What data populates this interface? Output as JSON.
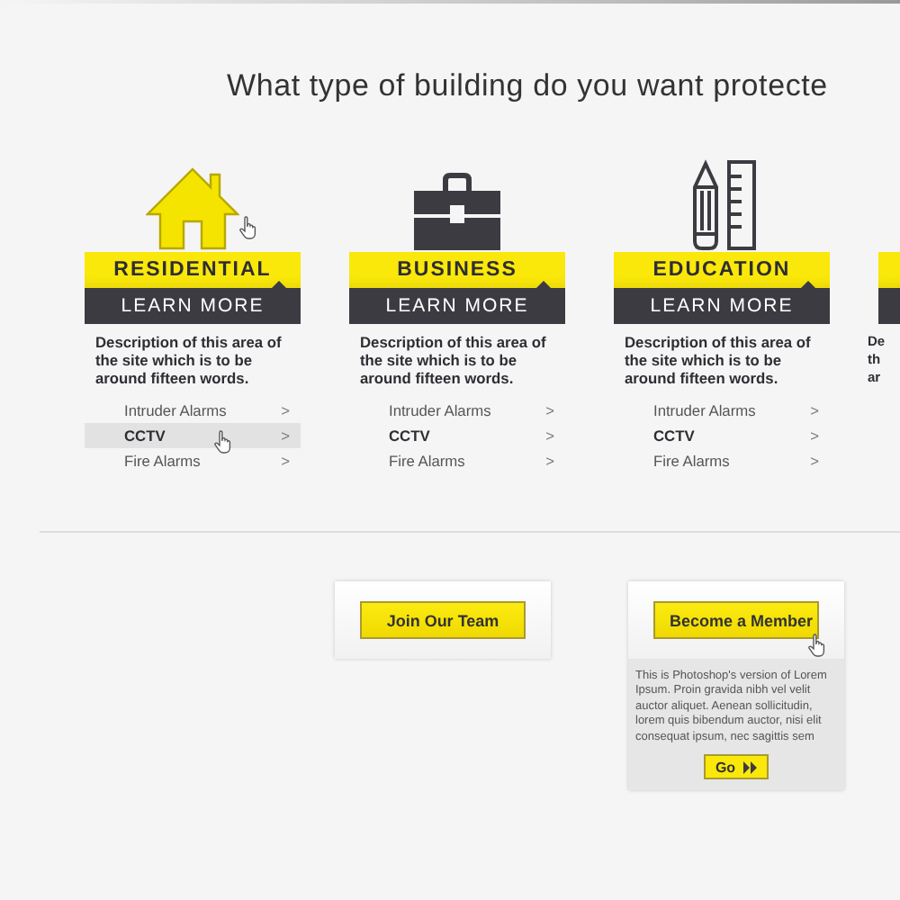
{
  "heading": "What type of building do you want protecte",
  "categories": [
    {
      "kind": "full",
      "icon_pointer": true,
      "title": "RESIDENTIAL",
      "button": "LEARN MORE",
      "description": "Description of this area of the site which is to be around fifteen words.",
      "links": [
        {
          "label": "Intruder Alarms",
          "chevron": ">",
          "bold": false,
          "selected": false,
          "pointer": false
        },
        {
          "label": "CCTV",
          "chevron": ">",
          "bold": true,
          "selected": true,
          "pointer": true
        },
        {
          "label": "Fire Alarms",
          "chevron": ">",
          "bold": false,
          "selected": false,
          "pointer": false
        }
      ]
    },
    {
      "kind": "full",
      "icon_pointer": false,
      "title": "BUSINESS",
      "button": "LEARN MORE",
      "description": "Description of this area of the site which is to be around fifteen words.",
      "links": [
        {
          "label": "Intruder Alarms",
          "chevron": ">",
          "bold": false,
          "selected": false,
          "pointer": false
        },
        {
          "label": "CCTV",
          "chevron": ">",
          "bold": true,
          "selected": false,
          "pointer": false
        },
        {
          "label": "Fire Alarms",
          "chevron": ">",
          "bold": false,
          "selected": false,
          "pointer": false
        }
      ]
    },
    {
      "kind": "full",
      "icon_pointer": false,
      "title": "EDUCATION",
      "button": "LEARN MORE",
      "description": "Description of this area of the site which is to be around fifteen words.",
      "links": [
        {
          "label": "Intruder Alarms",
          "chevron": ">",
          "bold": false,
          "selected": false,
          "pointer": false
        },
        {
          "label": "CCTV",
          "chevron": ">",
          "bold": true,
          "selected": false,
          "pointer": false
        },
        {
          "label": "Fire Alarms",
          "chevron": ">",
          "bold": false,
          "selected": false,
          "pointer": false
        }
      ]
    },
    {
      "kind": "partial",
      "description_lines": [
        "De",
        "th",
        "ar"
      ]
    }
  ],
  "actions": [
    {
      "button": "Join Our Team",
      "expanded": false,
      "pointer": false
    },
    {
      "button": "Become a Member",
      "expanded": true,
      "pointer": true,
      "text": "This is Photoshop's version  of Lorem Ipsum. Proin gravida nibh vel velit auctor aliquet. Aenean sollicitudin, lorem quis bibendum auctor, nisi elit consequat ipsum, nec sagittis sem",
      "go": "Go"
    }
  ]
}
